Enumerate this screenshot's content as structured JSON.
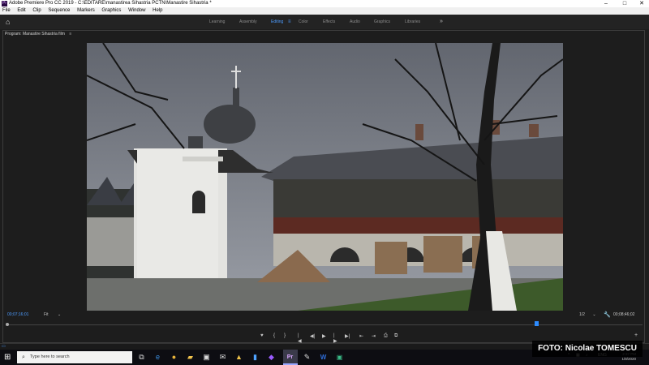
{
  "window": {
    "title": "Adobe Premiere Pro CC 2019 - C:\\EDITARE\\manastirea Sihastria PCTN\\Manastire Sihastria *",
    "app_icon_text": "Pr",
    "minimize": "–",
    "maximize": "□",
    "close": "✕"
  },
  "menu": [
    "File",
    "Edit",
    "Clip",
    "Sequence",
    "Markers",
    "Graphics",
    "Window",
    "Help"
  ],
  "workspace": {
    "tabs": [
      "Learning",
      "Assembly",
      "Editing",
      "Color",
      "Effects",
      "Audio",
      "Graphics",
      "Libraries"
    ],
    "active_tab": "Editing",
    "more": "»",
    "menu_icon": "≡"
  },
  "program_monitor": {
    "title": "Program: Manastire Sihastria film",
    "menu": "≡",
    "timecode_current": "00;07;16;01",
    "fit": "Fit",
    "fit_arrow": "⌄",
    "resolution": "1/2",
    "resolution_arrow": "⌄",
    "timecode_total": "00;08;46;02",
    "playhead_fraction": 0.83
  },
  "transport": {
    "marker": "♥",
    "mark_in": "{",
    "mark_out": "}",
    "go_in": "|◀",
    "step_back": "◀|",
    "play": "▶",
    "step_forward": "|▶",
    "go_out": "▶|",
    "lift": "⇤",
    "extract": "⇥",
    "export_frame": "⎙",
    "compare": "⧉",
    "add": "+"
  },
  "taskbar": {
    "search_placeholder": "Type here to search",
    "time": "2:37 PM",
    "date": "1/8/2020",
    "lang": "ENG"
  },
  "overlay": {
    "credit": "FOTO: Nicolae TOMESCU"
  },
  "colors": {
    "accent_blue": "#4d9cff",
    "panel_bg": "#1d1d1d",
    "taskbar_bg": "#0d0d12"
  }
}
